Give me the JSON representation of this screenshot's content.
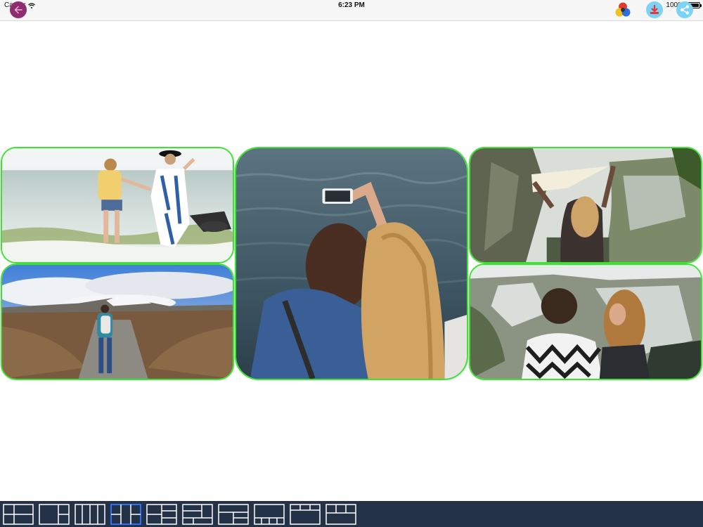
{
  "status_bar": {
    "carrier": "Carrier",
    "time": "6:23 PM",
    "battery_text": "100%",
    "battery_level": 1.0
  },
  "toolbar": {
    "back_icon": "arrow-left-icon",
    "colors_icon": "color-circles-icon",
    "download_icon": "download-icon",
    "share_icon": "share-icon",
    "accent_back": "#8e2d6f",
    "accent_buttons": "#7dd3f5"
  },
  "collage": {
    "border_color": "#39e62f",
    "photos": [
      {
        "subject": "two women walking into the sea holding hands"
      },
      {
        "subject": "hiker with backpack on a trail toward a snowy mountain"
      },
      {
        "subject": "two women taking a selfie by the sea"
      },
      {
        "subject": "woman holding a pennant flag above a canyon"
      },
      {
        "subject": "couple overlooking a quarry cliff"
      }
    ]
  },
  "layout_bar": {
    "background": "#233246",
    "selected_index": 3,
    "selected_color": "#2f6fff",
    "thumbs": [
      {
        "name": "2x2-grid"
      },
      {
        "name": "left-big-right-split"
      },
      {
        "name": "four-columns"
      },
      {
        "name": "side-split-center"
      },
      {
        "name": "left-big-right-three-rows"
      },
      {
        "name": "offset-blocks"
      },
      {
        "name": "top-wide-bottom-split"
      },
      {
        "name": "bottom-four-strip"
      },
      {
        "name": "top-strip-three"
      },
      {
        "name": "top-split-bottom-wide"
      }
    ]
  }
}
